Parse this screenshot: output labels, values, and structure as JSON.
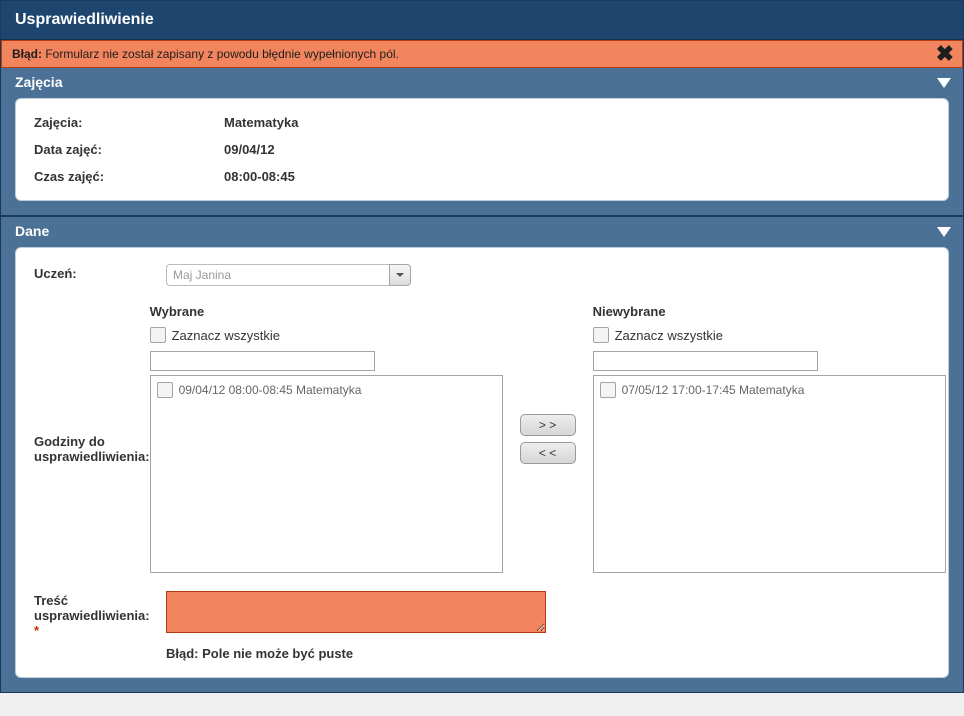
{
  "page_title": "Usprawiedliwienie",
  "error_banner": {
    "prefix": "Błąd:",
    "message": "Formularz nie został zapisany z powodu błędnie wypełnionych pól."
  },
  "section_zajecia": {
    "title": "Zajęcia",
    "rows": {
      "zajecia_label": "Zajęcia:",
      "zajecia_value": "Matematyka",
      "data_label": "Data zajęć:",
      "data_value": "09/04/12",
      "czas_label": "Czas zajęć:",
      "czas_value": "08:00-08:45"
    }
  },
  "section_dane": {
    "title": "Dane",
    "uczen_label": "Uczeń:",
    "uczen_value": "Maj Janina",
    "godziny_label": "Godziny do usprawiedliwienia:",
    "wybrane_header": "Wybrane",
    "niewybrane_header": "Niewybrane",
    "select_all_label": "Zaznacz wszystkie",
    "move_right": "> >",
    "move_left": "< <",
    "wybrane_items": [
      {
        "text": "09/04/12 08:00-08:45 Matematyka"
      }
    ],
    "niewybrane_items": [
      {
        "text": "07/05/12 17:00-17:45 Matematyka"
      }
    ],
    "tresc_label": "Treść usprawiedliwienia:",
    "tresc_value": "",
    "tresc_error_prefix": "Błąd:",
    "tresc_error_msg": "Pole nie może być puste"
  }
}
